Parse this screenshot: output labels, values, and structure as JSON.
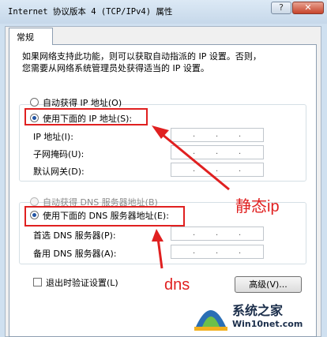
{
  "window": {
    "title": "Internet 协议版本 4 (TCP/IPv4) 属性",
    "close_glyph": "✕",
    "help_glyph": "?"
  },
  "tab": {
    "label": "常规"
  },
  "description": {
    "line1": "如果网络支持此功能，则可以获取自动指派的 IP 设置。否则，",
    "line2": "您需要从网络系统管理员处获得适当的 IP 设置。"
  },
  "ip_section": {
    "auto_label": "自动获得 IP 地址(O)",
    "manual_label": "使用下面的 IP 地址(S):",
    "selected": "manual",
    "fields": [
      {
        "label": "IP 地址(I):",
        "value": ""
      },
      {
        "label": "子网掩码(U):",
        "value": ""
      },
      {
        "label": "默认网关(D):",
        "value": ""
      }
    ]
  },
  "dns_section": {
    "auto_label": "自动获得 DNS 服务器地址(B)",
    "manual_label": "使用下面的 DNS 服务器地址(E):",
    "selected": "manual",
    "fields": [
      {
        "label": "首选 DNS 服务器(P):",
        "value": ""
      },
      {
        "label": "备用 DNS 服务器(A):",
        "value": ""
      }
    ]
  },
  "validate": {
    "label": "退出时验证设置(L)",
    "checked": false
  },
  "advanced_button": "高级(V)...",
  "annotations": {
    "ip_note": "静态ip",
    "dns_note": "dns"
  },
  "watermark": {
    "brand": "系统之家",
    "url": "Win10net.com"
  },
  "colors": {
    "annotation_red": "#e02020",
    "selected_radio": "#2255a4",
    "title_bar": "#c6d8ea"
  }
}
